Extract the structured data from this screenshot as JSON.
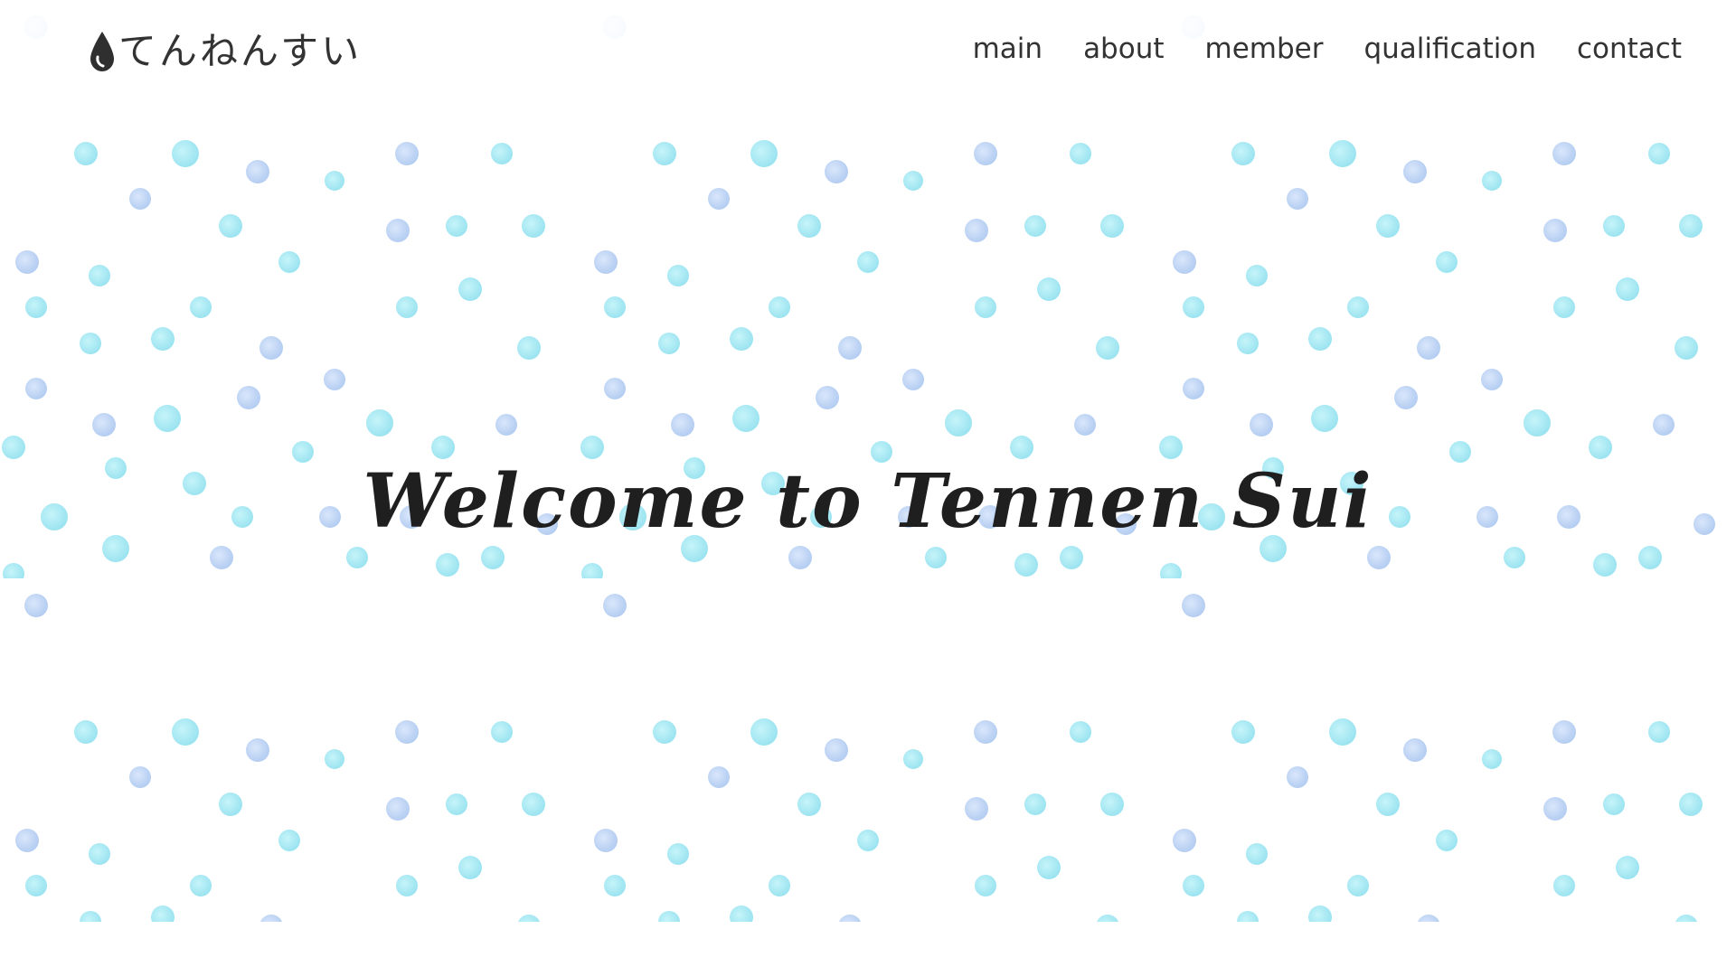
{
  "header": {
    "logo_icon": "water-drop-icon",
    "logo_text": "てんねんすい",
    "nav": [
      {
        "label": "main"
      },
      {
        "label": "about"
      },
      {
        "label": "member"
      },
      {
        "label": "qualification"
      },
      {
        "label": "contact"
      }
    ]
  },
  "hero": {
    "title": "Welcome to Tennen Sui"
  },
  "colors": {
    "text": "#333333",
    "dot_cyan": "#8be6f2",
    "dot_blue": "#a9c9f3",
    "background": "#ffffff"
  }
}
